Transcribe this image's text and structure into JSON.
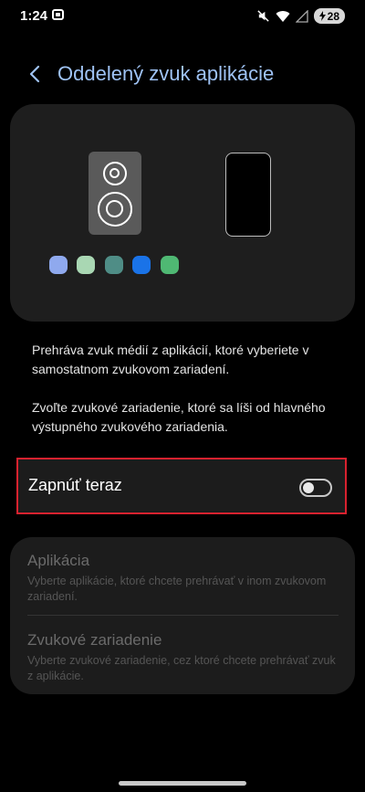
{
  "status_bar": {
    "time": "1:24",
    "battery": "28"
  },
  "header": {
    "title": "Oddelený zvuk aplikácie"
  },
  "illustration": {
    "dot_colors": [
      "#8fa9ee",
      "#a9d7b3",
      "#4f8d86",
      "#1a73e8",
      "#4fb873"
    ]
  },
  "description": {
    "paragraph1": "Prehráva zvuk médií z aplikácií, ktoré vyberiete v samostatnom zvukovom zariadení.",
    "paragraph2": "Zvoľte zvukové zariadenie, ktoré sa líši od hlavného výstupného zvukového zariadenia."
  },
  "toggle": {
    "label": "Zapnúť teraz",
    "enabled": false
  },
  "settings": {
    "app": {
      "title": "Aplikácia",
      "subtitle": "Vyberte aplikácie, ktoré chcete prehrávať v inom zvukovom zariadení."
    },
    "device": {
      "title": "Zvukové zariadenie",
      "subtitle": "Vyberte zvukové zariadenie, cez ktoré chcete prehrávať zvuk z aplikácie."
    }
  }
}
